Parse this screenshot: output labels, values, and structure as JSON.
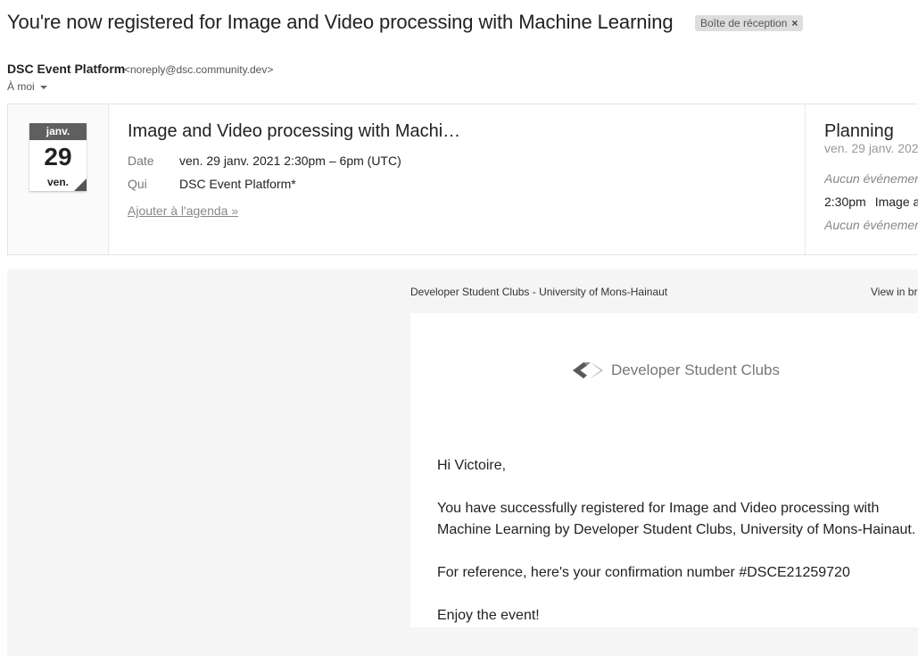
{
  "email": {
    "subject": "You're now registered for Image and Video processing with Machine Learning",
    "label": "Boîte de réception",
    "label_remove": "×",
    "sender_name": "DSC Event Platform",
    "sender_email": "<noreply@dsc.community.dev>",
    "recipient": "À moi"
  },
  "invite": {
    "calendar_month": "janv.",
    "calendar_day": "29",
    "calendar_weekday": "ven.",
    "event_title": "Image and Video processing with Machi…",
    "date_label": "Date",
    "date_value": "ven. 29 janv. 2021 2:30pm – 6pm (UTC)",
    "who_label": "Qui",
    "who_value": "DSC Event Platform*",
    "add_to_calendar": "Ajouter à l'agenda »"
  },
  "planning": {
    "title": "Planning",
    "date": "ven. 29 janv. 202",
    "no_event_before": "Aucun événemen",
    "event_time": "2:30pm",
    "event_name": "Image a",
    "no_event_after": "Aucun événemen"
  },
  "body": {
    "org_line": "Developer Student Clubs - University of Mons-Hainaut",
    "view_in_browser": "View in br",
    "logo_text": "Developer Student Clubs",
    "greeting": "Hi Victoire,",
    "para1_line1": "You have successfully registered for Image and Video processing with",
    "para1_line2": "Machine Learning by Developer Student Clubs, University of Mons-Hainaut.",
    "para2": "For reference, here's your confirmation number #DSCE21259720",
    "para3": "Enjoy the event!"
  }
}
